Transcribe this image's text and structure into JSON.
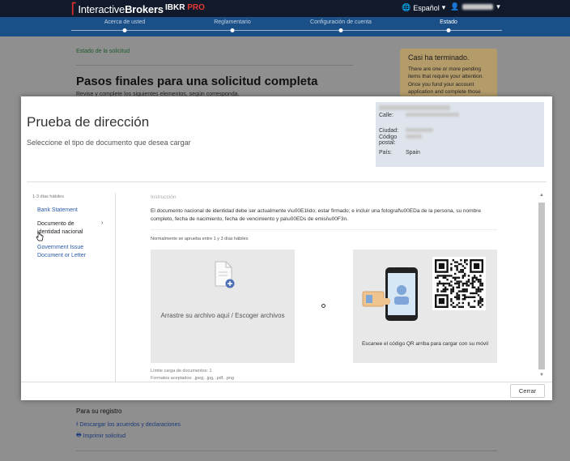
{
  "header": {
    "brand_prefix": "Interactive",
    "brand_suffix": "Brokers",
    "product": "IBKR",
    "product_tier": "PRO",
    "language": "Español"
  },
  "steps": [
    {
      "label": "Acerca de usted",
      "active": false
    },
    {
      "label": "Reglamentario",
      "active": false
    },
    {
      "label": "Configuración de cuenta",
      "active": false
    },
    {
      "label": "Estado",
      "active": true
    }
  ],
  "background": {
    "status_label": "Estado de la solicitud",
    "title": "Pasos finales para una solicitud completa",
    "subtitle": "Revise y complete los siguientes elementos, según corresponda.",
    "aside_title": "Casi ha terminado.",
    "aside_text": "There are one or more pending items that require your attention. Once you fund your account application and complete those",
    "registry_title": "Para su registro",
    "download_link": "Descargar los acuerdos y declaraciones",
    "print_link": "Imprimir solicitud"
  },
  "modal": {
    "title": "Prueba de dirección",
    "subtitle": "Seleccione el tipo de documento que desea cargar",
    "address": {
      "street_label": "Calle:",
      "city_label": "Ciudad:",
      "postal_label": "Código postal:",
      "country_label": "País:",
      "country": "Spain"
    },
    "timing": "1-3 días hábiles",
    "documents": [
      {
        "label": "Bank Statement",
        "active": false
      },
      {
        "label": "Documento de identidad nacional",
        "active": true,
        "arrow": "›"
      },
      {
        "label": "Government Issue Document or Letter",
        "active": false
      }
    ],
    "instruction_label": "Instrucción",
    "instruction_text": "El documento nacional de identidad debe ser actualmente v\\u00E1lido; estar firmado; e incluir una fotograf\\u00EDa de la persona, su nombre completo, fecha de nacimiento, fecha de vencimiento y pa\\u00EDs de emisi\\u00F3n.",
    "approval_note": "Normalmente se aprueba entre 1 y 3 días hábiles",
    "upload_text": "Arrastre su archivo aquí / Escoger archivos",
    "qr_text": "Escanee el código QR arriba para cargar con su móvil",
    "upload_limit": "Límite carga de documentos: 1",
    "formats": "Formatos aceptados: .jpeg, .jpg, .pdf, .png",
    "close_label": "Cerrar"
  },
  "colors": {
    "topbar": "#111a2a",
    "progress": "#1a4f87",
    "brand_red": "#d32f2f",
    "link_blue": "#2a5aa8"
  }
}
